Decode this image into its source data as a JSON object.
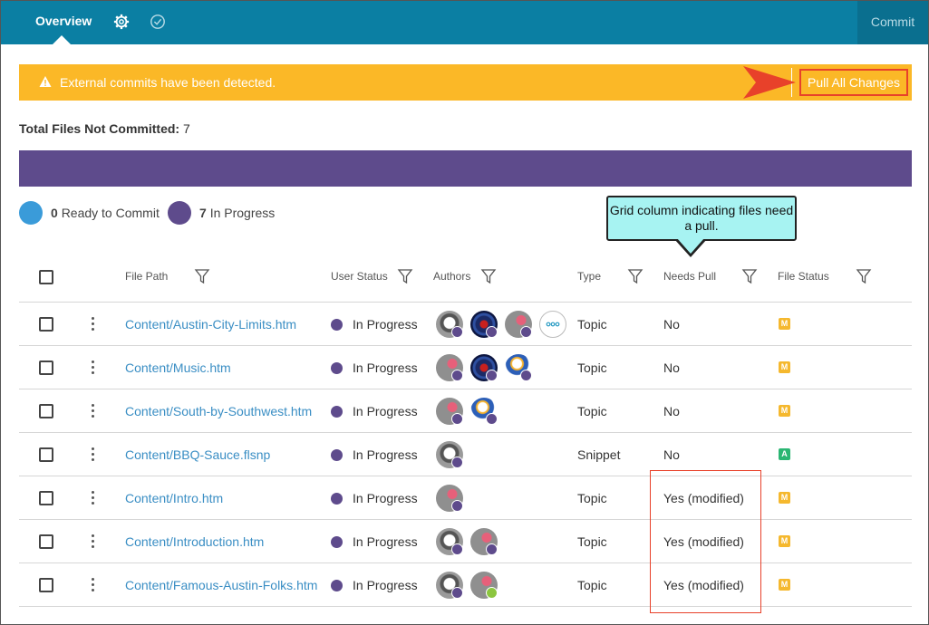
{
  "topbar": {
    "overview_label": "Overview",
    "commit_label": "Commit",
    "settings_icon": "gear-icon",
    "check_icon": "check-circle-icon"
  },
  "banner": {
    "message": "External commits have been detected.",
    "pull_button": "Pull All Changes",
    "warning_icon": "warning-icon"
  },
  "summary": {
    "label": "Total Files Not Committed:",
    "count": "7"
  },
  "legend": [
    {
      "count": "0",
      "label": "Ready to Commit",
      "color": "#3a9bd9"
    },
    {
      "count": "7",
      "label": "In Progress",
      "color": "#5e4b8c"
    }
  ],
  "callout": {
    "text": "Grid column indicating files need a pull."
  },
  "table": {
    "headers": {
      "file_path": "File Path",
      "user_status": "User Status",
      "authors": "Authors",
      "type": "Type",
      "needs_pull": "Needs Pull",
      "file_status": "File Status"
    },
    "rows": [
      {
        "path": "Content/Austin-City-Limits.htm",
        "status": "In Progress",
        "type": "Topic",
        "needs_pull": "No",
        "file_status": "M"
      },
      {
        "path": "Content/Music.htm",
        "status": "In Progress",
        "type": "Topic",
        "needs_pull": "No",
        "file_status": "M"
      },
      {
        "path": "Content/South-by-Southwest.htm",
        "status": "In Progress",
        "type": "Topic",
        "needs_pull": "No",
        "file_status": "M"
      },
      {
        "path": "Content/BBQ-Sauce.flsnp",
        "status": "In Progress",
        "type": "Snippet",
        "needs_pull": "No",
        "file_status": "A"
      },
      {
        "path": "Content/Intro.htm",
        "status": "In Progress",
        "type": "Topic",
        "needs_pull": "Yes (modified)",
        "file_status": "M"
      },
      {
        "path": "Content/Introduction.htm",
        "status": "In Progress",
        "type": "Topic",
        "needs_pull": "Yes (modified)",
        "file_status": "M"
      },
      {
        "path": "Content/Famous-Austin-Folks.htm",
        "status": "In Progress",
        "type": "Topic",
        "needs_pull": "Yes (modified)",
        "file_status": "M"
      }
    ]
  },
  "colors": {
    "header": "#0b7fa3",
    "banner": "#fbb827",
    "progress": "#5e4b8c",
    "modified": "#f5b82e",
    "added": "#2bb673"
  }
}
